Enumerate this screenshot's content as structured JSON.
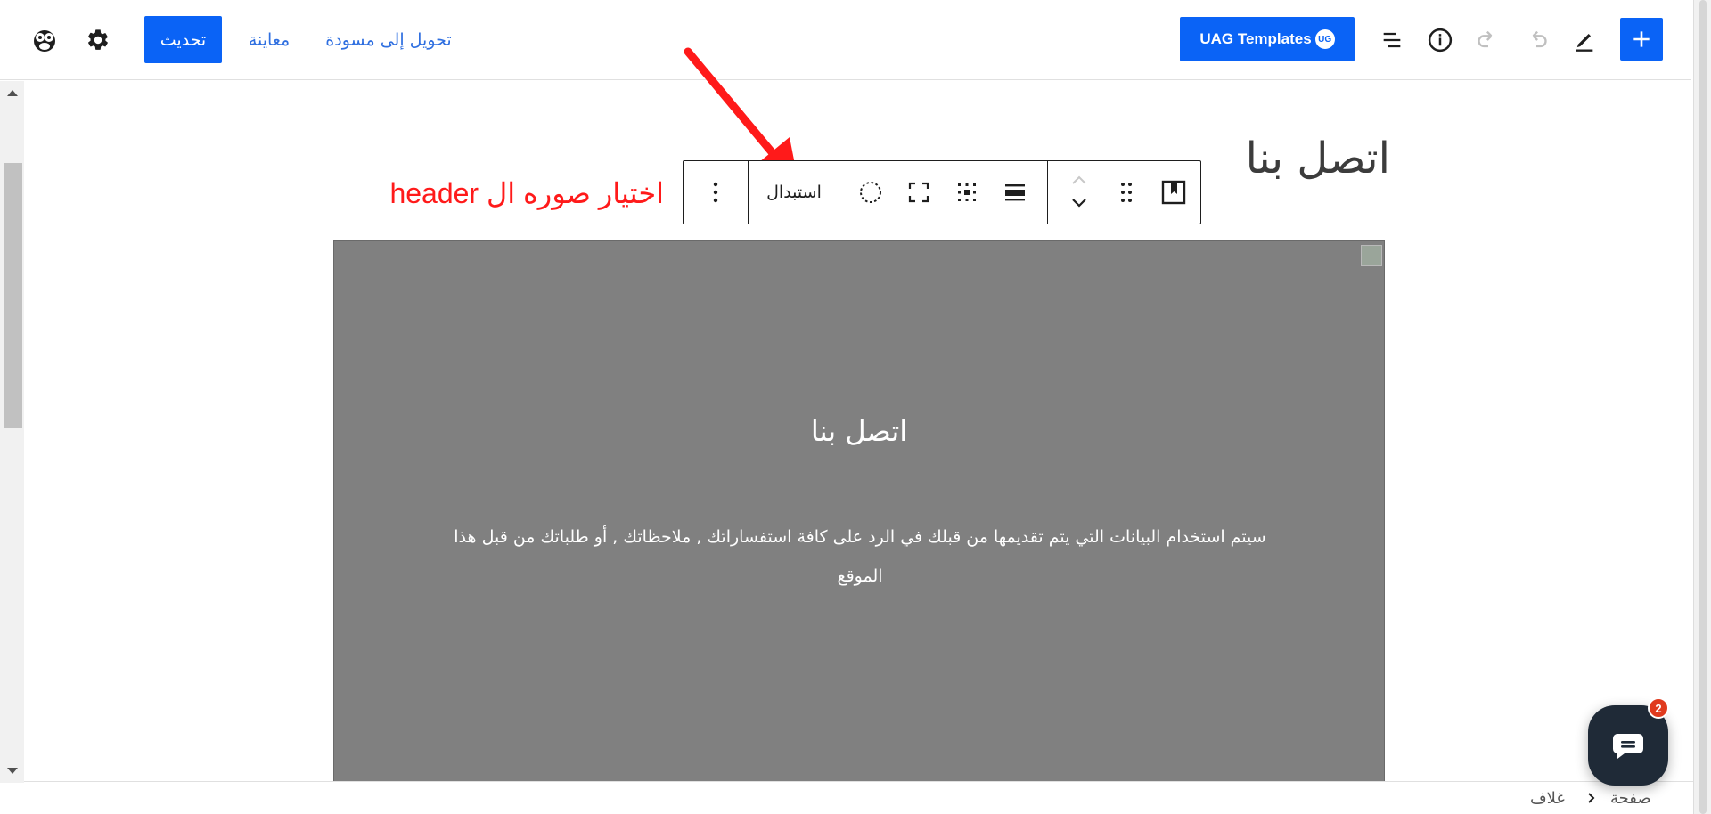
{
  "header": {
    "add_block_label": "+",
    "uag_templates_label": "UAG Templates",
    "uag_badge": "UG",
    "update_label": "تحديث",
    "preview_label": "معاينة",
    "switch_to_draft_label": "تحويل إلى مسودة"
  },
  "document": {
    "page_title": "اتصل بنا"
  },
  "block_toolbar": {
    "replace_label": "استبدال"
  },
  "annotation": {
    "text": "اختيار صوره ال header",
    "color": "#ff1a1a"
  },
  "cover_block": {
    "overlay_color": "#808080",
    "heading": "اتصل بنا",
    "paragraph": "سيتم استخدام البيانات التي يتم تقديمها من قبلك في الرد على كافة استفساراتك , ملاحظاتك , أو طلباتك من قبل هذا الموقع"
  },
  "breadcrumb": {
    "items": [
      "صفحة",
      "غلاف"
    ]
  },
  "chat_widget": {
    "badge_count": "2"
  },
  "colors": {
    "accent": "#0a63f6",
    "link": "#2f6fe0"
  }
}
